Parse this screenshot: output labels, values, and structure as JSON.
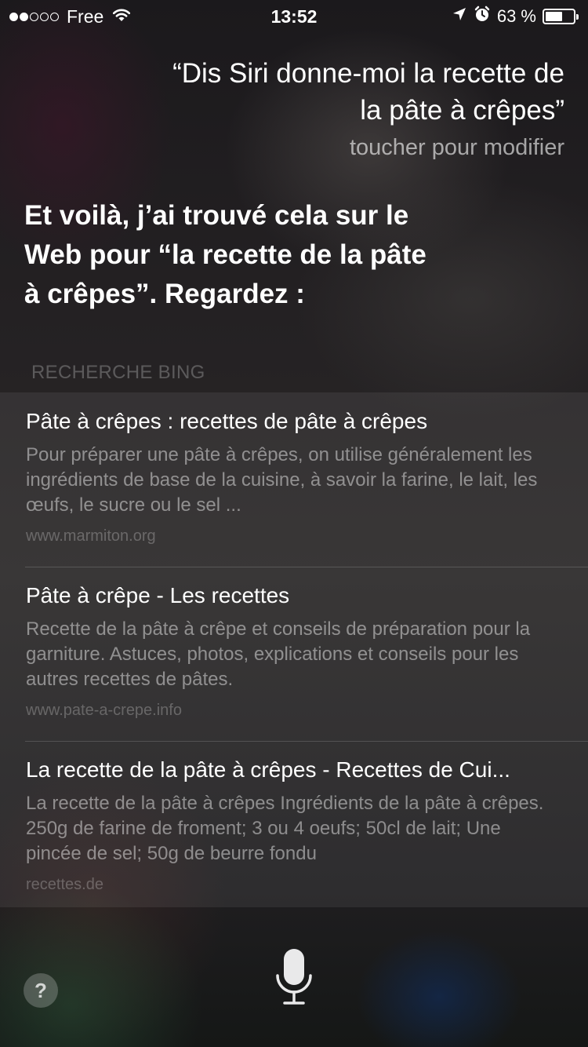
{
  "status_bar": {
    "signal_full": 2,
    "signal_total": 5,
    "carrier": "Free",
    "time": "13:52",
    "battery_text": "63 %",
    "battery_level": 0.63,
    "icons": [
      "wifi-icon",
      "location-arrow-icon",
      "alarm-icon",
      "battery-icon"
    ]
  },
  "query": {
    "line1": "“Dis Siri donne-moi la recette de",
    "line2": "la pâte à crêpes”",
    "tap_to_edit": "toucher pour modifier"
  },
  "answer": {
    "line1": "Et voilà, j’ai trouvé cela sur le",
    "line2": "Web pour “la recette de la pâte",
    "line3": "à crêpes”. Regardez :"
  },
  "section_label": "RECHERCHE BING",
  "results": [
    {
      "title": "Pâte à crêpes : recettes de pâte à crêpes",
      "snippet": "Pour préparer une pâte à crêpes, on utilise généralement les ingrédients de base de la cuisine, à savoir la farine, le lait, les œufs, le sucre ou le sel ...",
      "url": "www.marmiton.org"
    },
    {
      "title": "Pâte à crêpe - Les recettes",
      "snippet": "Recette de la pâte à crêpe et conseils de préparation pour la garniture. Astuces, photos, explications et conseils pour les autres recettes de pâtes.",
      "url": "www.pate-a-crepe.info"
    },
    {
      "title": "La recette de la pâte à crêpes - Recettes de Cui...",
      "snippet": "La recette de la pâte à crêpes Ingrédients de la pâte à crêpes. 250g de farine de froment; 3 ou 4 oeufs; 50cl de lait; Une pincée de sel; 50g de beurre fondu",
      "url": "recettes.de"
    }
  ],
  "bottom": {
    "help_label": "?",
    "mic_icon": "microphone-icon"
  }
}
